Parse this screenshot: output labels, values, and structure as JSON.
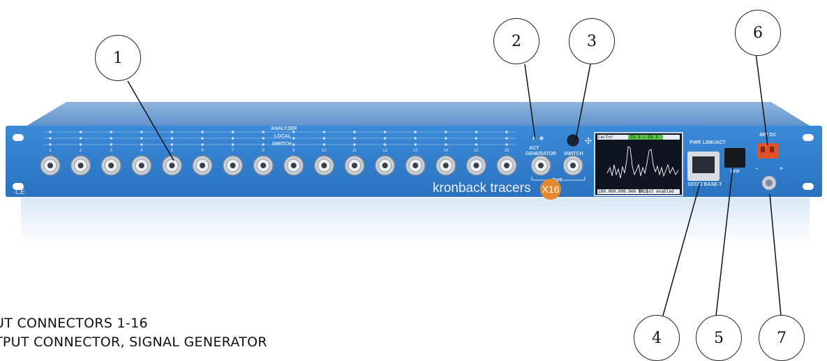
{
  "device": {
    "brand_name": "kronback tracers",
    "model_badge": "X16",
    "ce_mark": "CE",
    "labels": {
      "analyzer": "ANALYZER",
      "local": "LOCAL",
      "switch_row": "SWITCH",
      "act": "ACT",
      "generator": "GENERATOR",
      "switch_button": "SWITCH",
      "dut": "DUT",
      "pwr": "PWR",
      "link_act": "LINK/ACT",
      "ethernet": "10/100 BASE-T",
      "sfp": "SFP",
      "power": "48V DC",
      "ground_minus": "-",
      "ground_plus": "+"
    },
    "port_numbers": [
      "1",
      "2",
      "3",
      "4",
      "5",
      "6",
      "7",
      "8",
      "9",
      "10",
      "11",
      "12",
      "13",
      "14",
      "15",
      "16"
    ],
    "screen": {
      "tab_left": "Lector",
      "tab_right": "Ch 1 - Ch 1",
      "footer_left": "100.000.000.000 [Hz]",
      "footer_right": "RF not enabled"
    }
  },
  "callouts": [
    "1",
    "2",
    "3",
    "4",
    "5",
    "6",
    "7"
  ],
  "legend": [
    "UT CONNECTORS 1-16",
    "TPUT CONNECTOR, SIGNAL GENERATOR"
  ],
  "colors": {
    "panel": "#2f7fd0",
    "panel_dark": "#1f5fa8",
    "accent_orange": "#e58a2c",
    "power_connector": "#e0532a"
  }
}
